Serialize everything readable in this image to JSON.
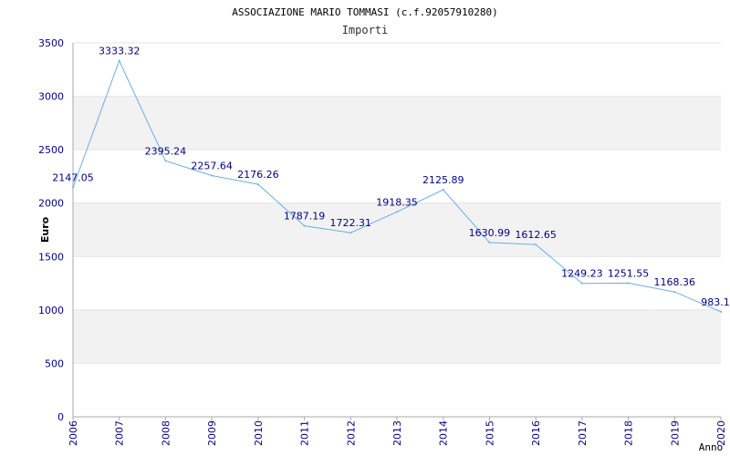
{
  "chart_data": {
    "type": "line",
    "title": "ASSOCIAZIONE MARIO TOMMASI (c.f.92057910280)",
    "subtitle": "Importi",
    "xlabel": "Anno",
    "ylabel": "Euro",
    "ylim": [
      0,
      3500
    ],
    "yticks": [
      0,
      500,
      1000,
      1500,
      2000,
      2500,
      3000,
      3500
    ],
    "grid": true,
    "legend": "none",
    "categories": [
      "2006",
      "2007",
      "2008",
      "2009",
      "2010",
      "2011",
      "2012",
      "2013",
      "2014",
      "2015",
      "2016",
      "2017",
      "2018",
      "2019",
      "2020"
    ],
    "values": [
      2147.05,
      3333.32,
      2395.24,
      2257.64,
      2176.26,
      1787.19,
      1722.31,
      1918.35,
      2125.89,
      1630.99,
      1612.65,
      1249.23,
      1251.55,
      1168.36,
      983.1
    ],
    "data_labels": [
      "2147.05",
      "3333.32",
      "2395.24",
      "2257.64",
      "2176.26",
      "1787.19",
      "1722.31",
      "1918.35",
      "2125.89",
      "1630.99",
      "1612.65",
      "1249.23",
      "1251.55",
      "1168.36",
      "983.1"
    ],
    "colors": {
      "line": "#6aaee6",
      "band": "#f2f2f2",
      "axis": "#aaaaaa",
      "tick_text": "#00008b"
    }
  }
}
